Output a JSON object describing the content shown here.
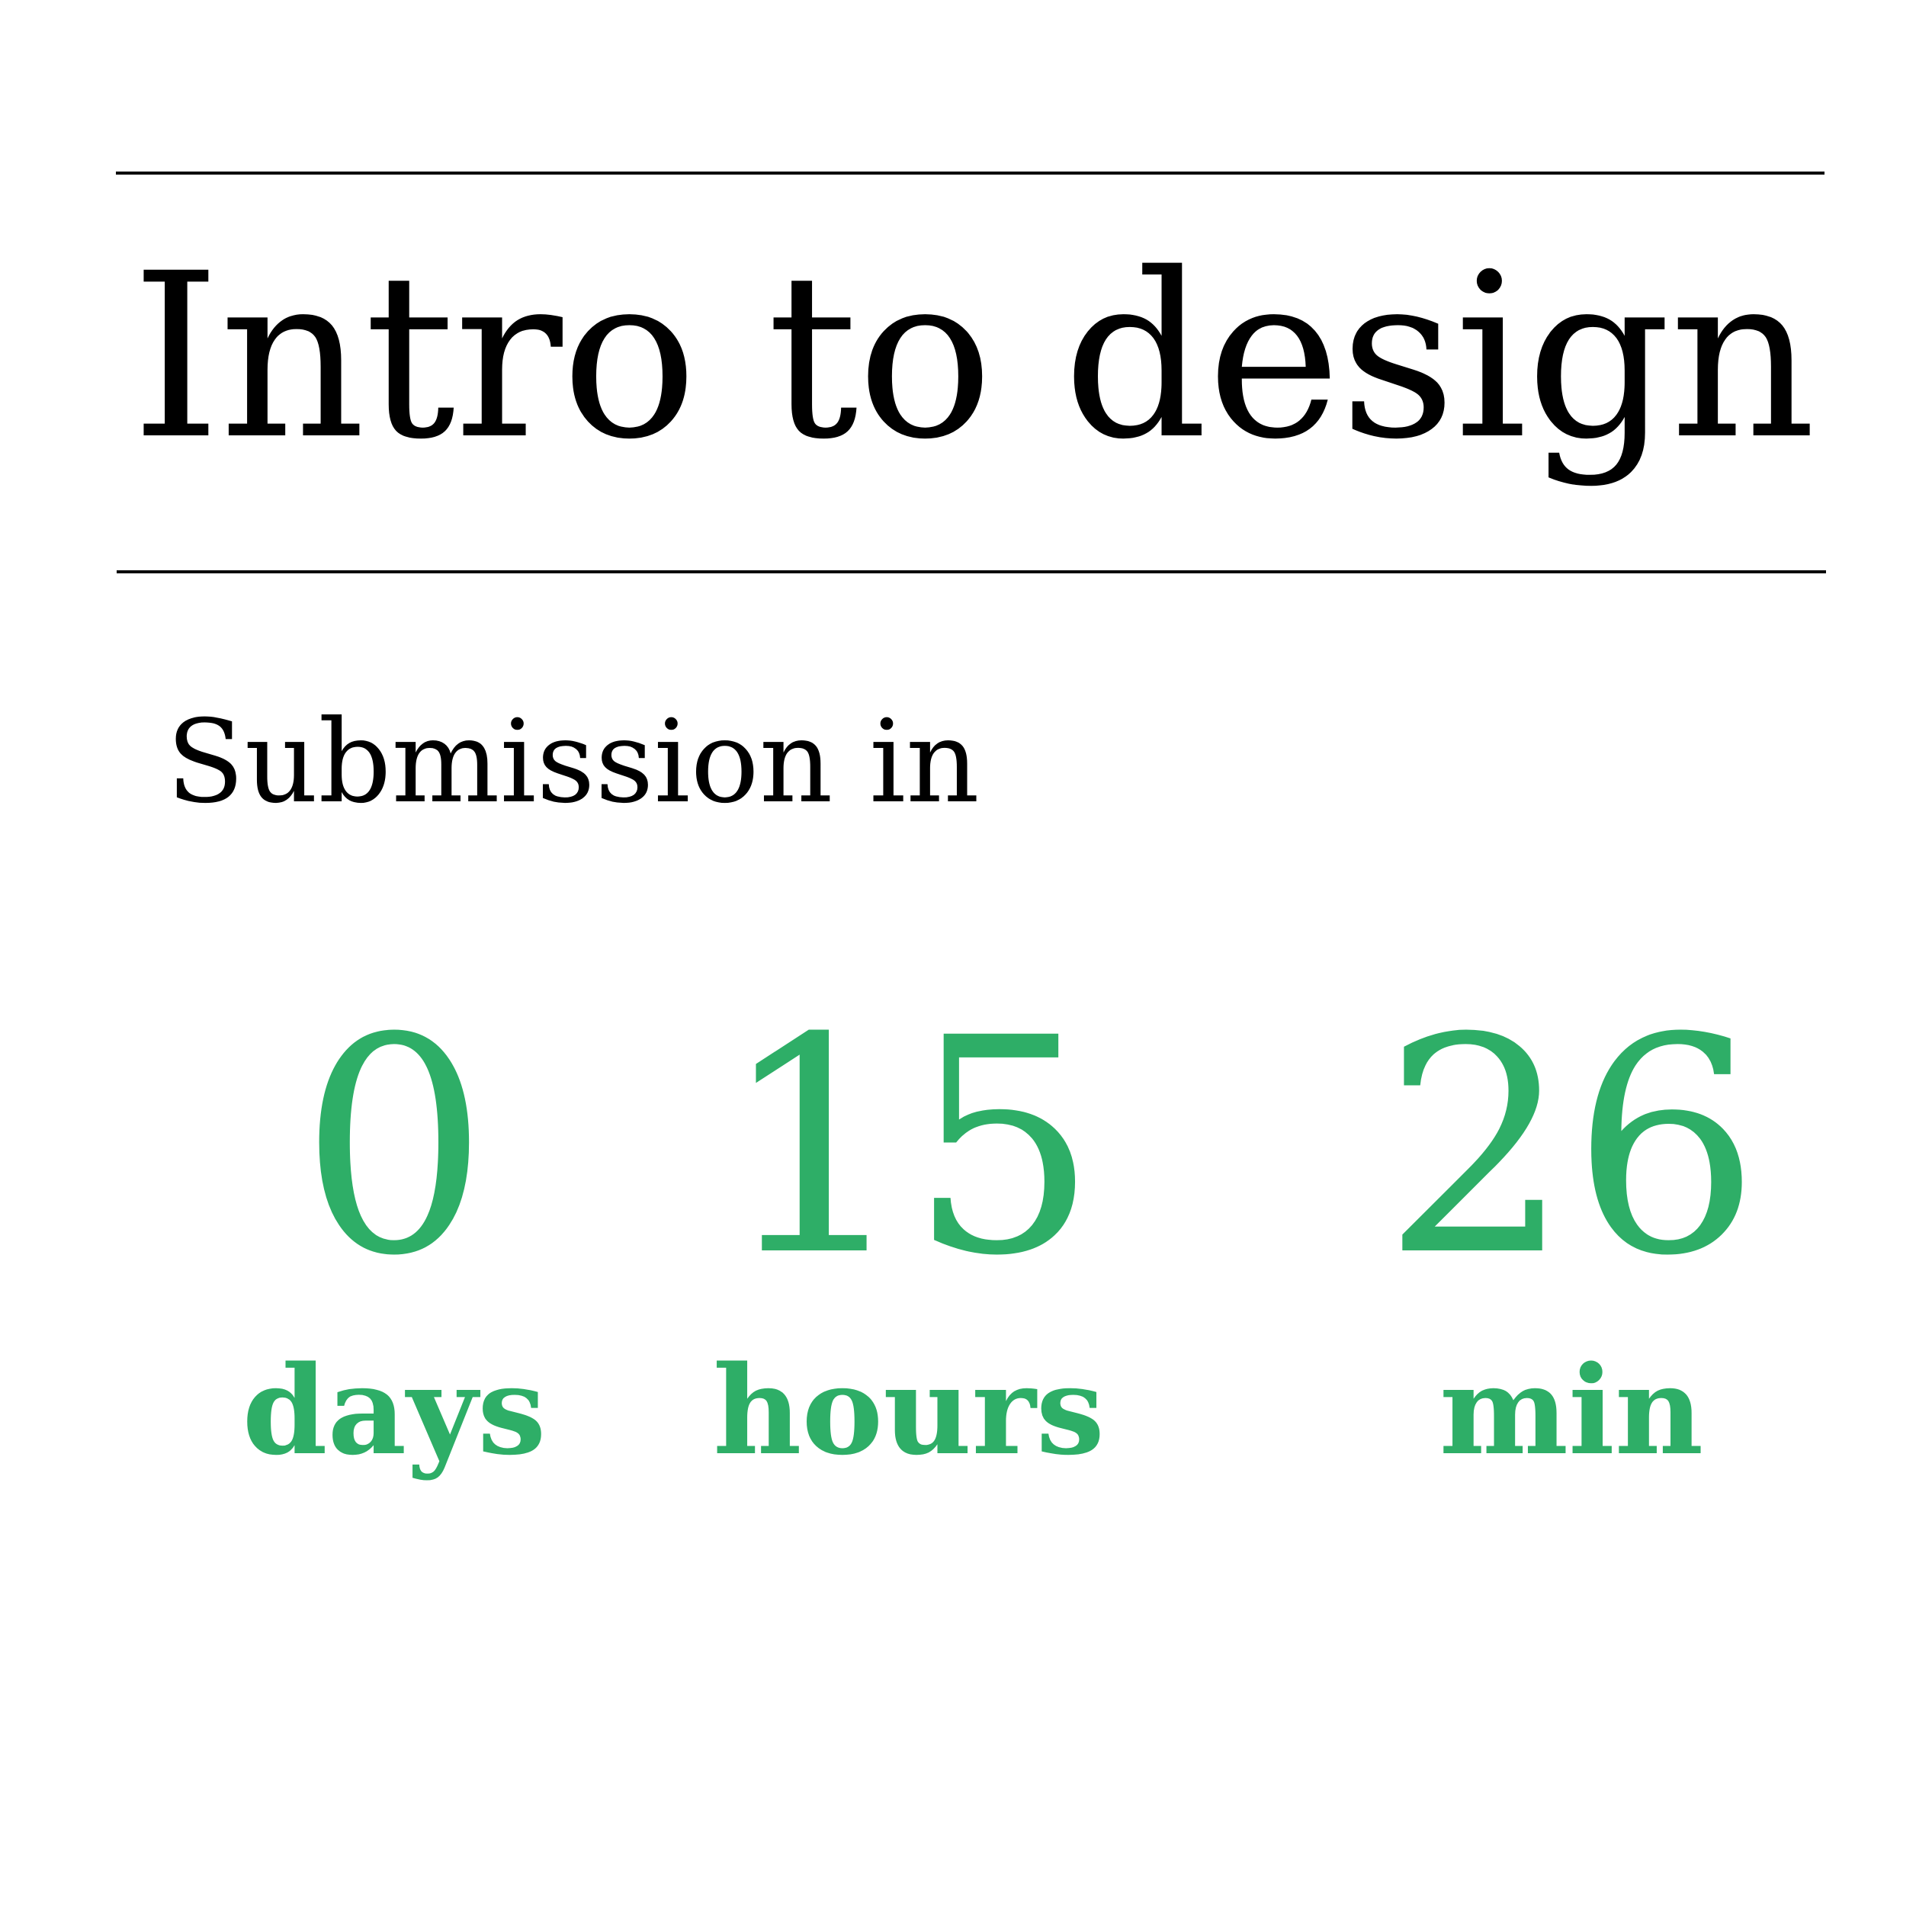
{
  "title": "Intro to design",
  "subtitle": "Submission in",
  "countdown": {
    "days": {
      "value": "0",
      "label": "days"
    },
    "hours": {
      "value": "15",
      "label": "hours"
    },
    "minutes": {
      "value": "26",
      "label": "min"
    }
  },
  "colors": {
    "accent": "#2eae67",
    "text": "#000000",
    "rule": "#000000",
    "background": "#ffffff"
  }
}
